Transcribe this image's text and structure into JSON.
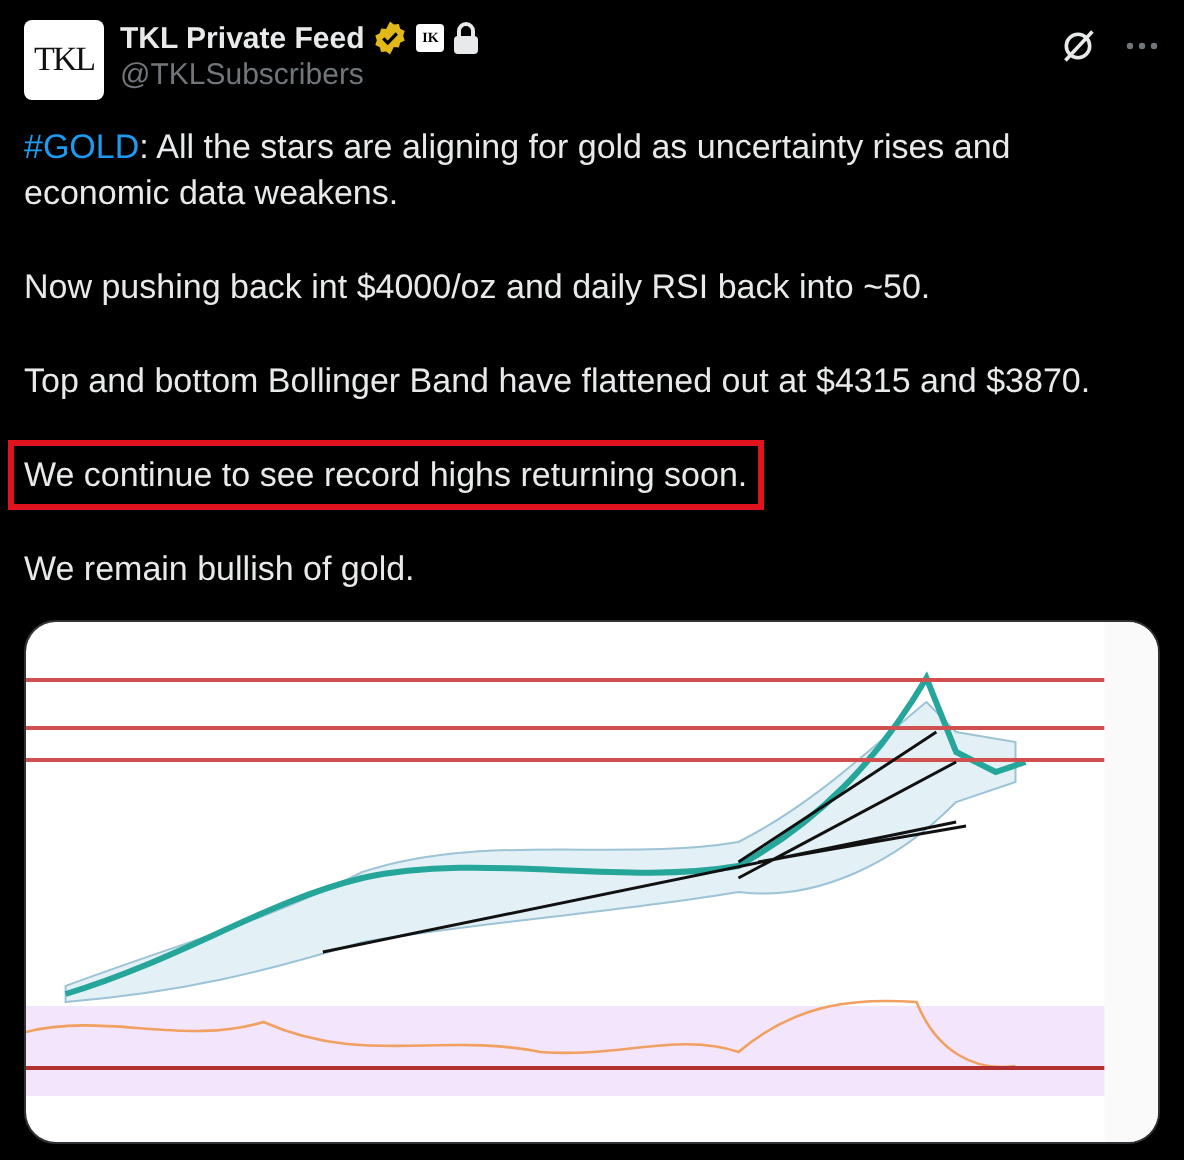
{
  "author": {
    "avatar_text": "TKL",
    "name": "TKL Private Feed",
    "handle": "@TKLSubscribers",
    "verified": true,
    "affiliate_text": "IK",
    "protected": true
  },
  "paragraphs": [
    {
      "hashtag": "#GOLD",
      "text": ": All the stars are aligning for gold as uncertainty rises and economic data weakens.",
      "boxed": false
    },
    {
      "text": "Now pushing back int $4000/oz and daily RSI back into ~50.",
      "boxed": false
    },
    {
      "text": "Top and bottom Bollinger Band have flattened out at $4315 and $3870.",
      "boxed": false
    },
    {
      "text": "We continue to see record highs returning soon.",
      "boxed": true
    },
    {
      "text": "We remain bullish of gold.",
      "boxed": false
    }
  ]
}
